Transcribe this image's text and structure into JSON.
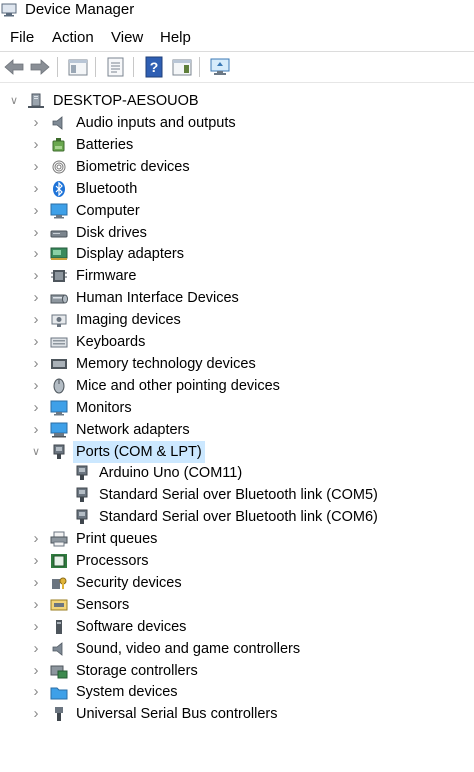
{
  "window": {
    "title": "Device Manager"
  },
  "menu": [
    "File",
    "Action",
    "View",
    "Help"
  ],
  "toolbar": [
    {
      "name": "back-arrow-icon"
    },
    {
      "name": "forward-arrow-icon"
    },
    {
      "name": "show-hide-console-tree-icon"
    },
    {
      "name": "properties-icon"
    },
    {
      "name": "help-icon"
    },
    {
      "name": "action-pane-icon"
    },
    {
      "name": "scan-hardware-changes-icon"
    }
  ],
  "tree": {
    "root": "DESKTOP-AESOUOB",
    "categories": [
      {
        "label": "Audio inputs and outputs",
        "icon": "speaker-icon"
      },
      {
        "label": "Batteries",
        "icon": "battery-icon"
      },
      {
        "label": "Biometric devices",
        "icon": "fingerprint-icon"
      },
      {
        "label": "Bluetooth",
        "icon": "bluetooth-icon"
      },
      {
        "label": "Computer",
        "icon": "computer-icon"
      },
      {
        "label": "Disk drives",
        "icon": "disk-drive-icon"
      },
      {
        "label": "Display adapters",
        "icon": "display-adapter-icon"
      },
      {
        "label": "Firmware",
        "icon": "firmware-icon"
      },
      {
        "label": "Human Interface Devices",
        "icon": "hid-icon"
      },
      {
        "label": "Imaging devices",
        "icon": "camera-icon"
      },
      {
        "label": "Keyboards",
        "icon": "keyboard-icon"
      },
      {
        "label": "Memory technology devices",
        "icon": "memory-icon"
      },
      {
        "label": "Mice and other pointing devices",
        "icon": "mouse-icon"
      },
      {
        "label": "Monitors",
        "icon": "monitor-icon"
      },
      {
        "label": "Network adapters",
        "icon": "network-adapter-icon"
      },
      {
        "label": "Ports (COM & LPT)",
        "icon": "port-icon",
        "expanded": true,
        "selected": true,
        "children": [
          "Arduino Uno (COM11)",
          "Standard Serial over Bluetooth link (COM5)",
          "Standard Serial over Bluetooth link (COM6)"
        ]
      },
      {
        "label": "Print queues",
        "icon": "printer-icon"
      },
      {
        "label": "Processors",
        "icon": "processor-icon"
      },
      {
        "label": "Security devices",
        "icon": "security-key-icon"
      },
      {
        "label": "Sensors",
        "icon": "sensor-icon"
      },
      {
        "label": "Software devices",
        "icon": "software-device-icon"
      },
      {
        "label": "Sound, video and game controllers",
        "icon": "speaker-icon"
      },
      {
        "label": "Storage controllers",
        "icon": "storage-controller-icon"
      },
      {
        "label": "System devices",
        "icon": "system-folder-icon"
      },
      {
        "label": "Universal Serial Bus controllers",
        "icon": "usb-icon"
      }
    ]
  }
}
